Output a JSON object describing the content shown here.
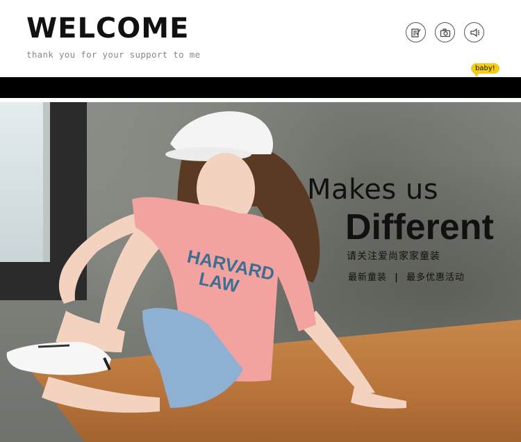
{
  "header": {
    "title": "WELCOME",
    "tagline": "thank you for your support to me",
    "icons": [
      "edit-document-icon",
      "camera-icon",
      "megaphone-icon"
    ],
    "badge": "baby!"
  },
  "hero": {
    "headline_line1": "Makes us",
    "headline_line2": "Different",
    "subtitle": "请关注爱尚家家童装",
    "promo_part1": "最新童装",
    "separator": "|",
    "promo_part2": "最多优惠活动"
  },
  "colors": {
    "badge": "#f3cc1a",
    "bar": "#000000",
    "shirt": "#f2a3a0",
    "bench": "#c8884a"
  }
}
